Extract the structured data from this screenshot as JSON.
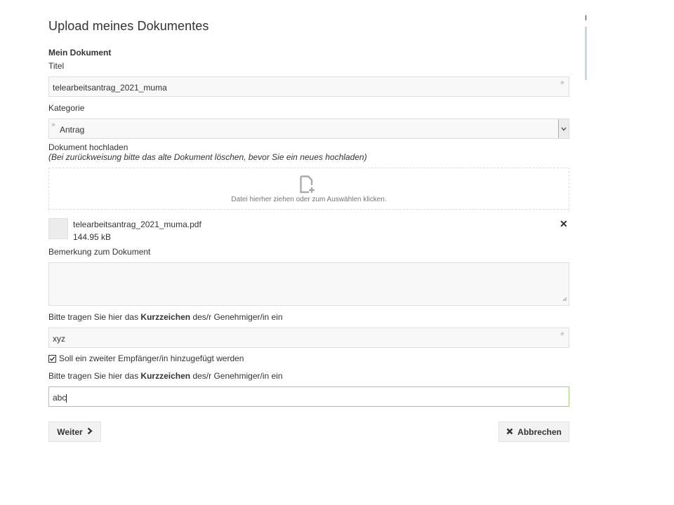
{
  "header": {
    "title": "Upload meines Dokumentes"
  },
  "form": {
    "section_title": "Mein Dokument",
    "titel_label": "Titel",
    "titel_value": "telearbeitsantrag_2021_muma",
    "kategorie_label": "Kategorie",
    "kategorie_value": "Antrag",
    "upload_label": "Dokument hochladen",
    "upload_hint": "(Bei zurückweisung bitte das alte Dokument löschen, bevor Sie ein neues hochladen)",
    "dropzone_text": "Datei hierher ziehen oder zum Auswählen klicken.",
    "file": {
      "name": "telearbeitsantrag_2021_muma.pdf",
      "size": "144.95 kB"
    },
    "remark_label": "Bemerkung zum Dokument",
    "kurz_label_pre": "Bitte tragen Sie hier das ",
    "kurz_label_bold": "Kurzzeichen",
    "kurz_label_post": " des/r Genehmiger/in ein",
    "kurz1_value": "xyz",
    "checkbox_label": "Soll ein zweiter Empfänger/in hinzugefügt werden",
    "checkbox_checked": true,
    "kurz2_value": "abc"
  },
  "buttons": {
    "next": "Weiter",
    "cancel": "Abbrechen"
  },
  "side": {
    "letter": "I"
  }
}
